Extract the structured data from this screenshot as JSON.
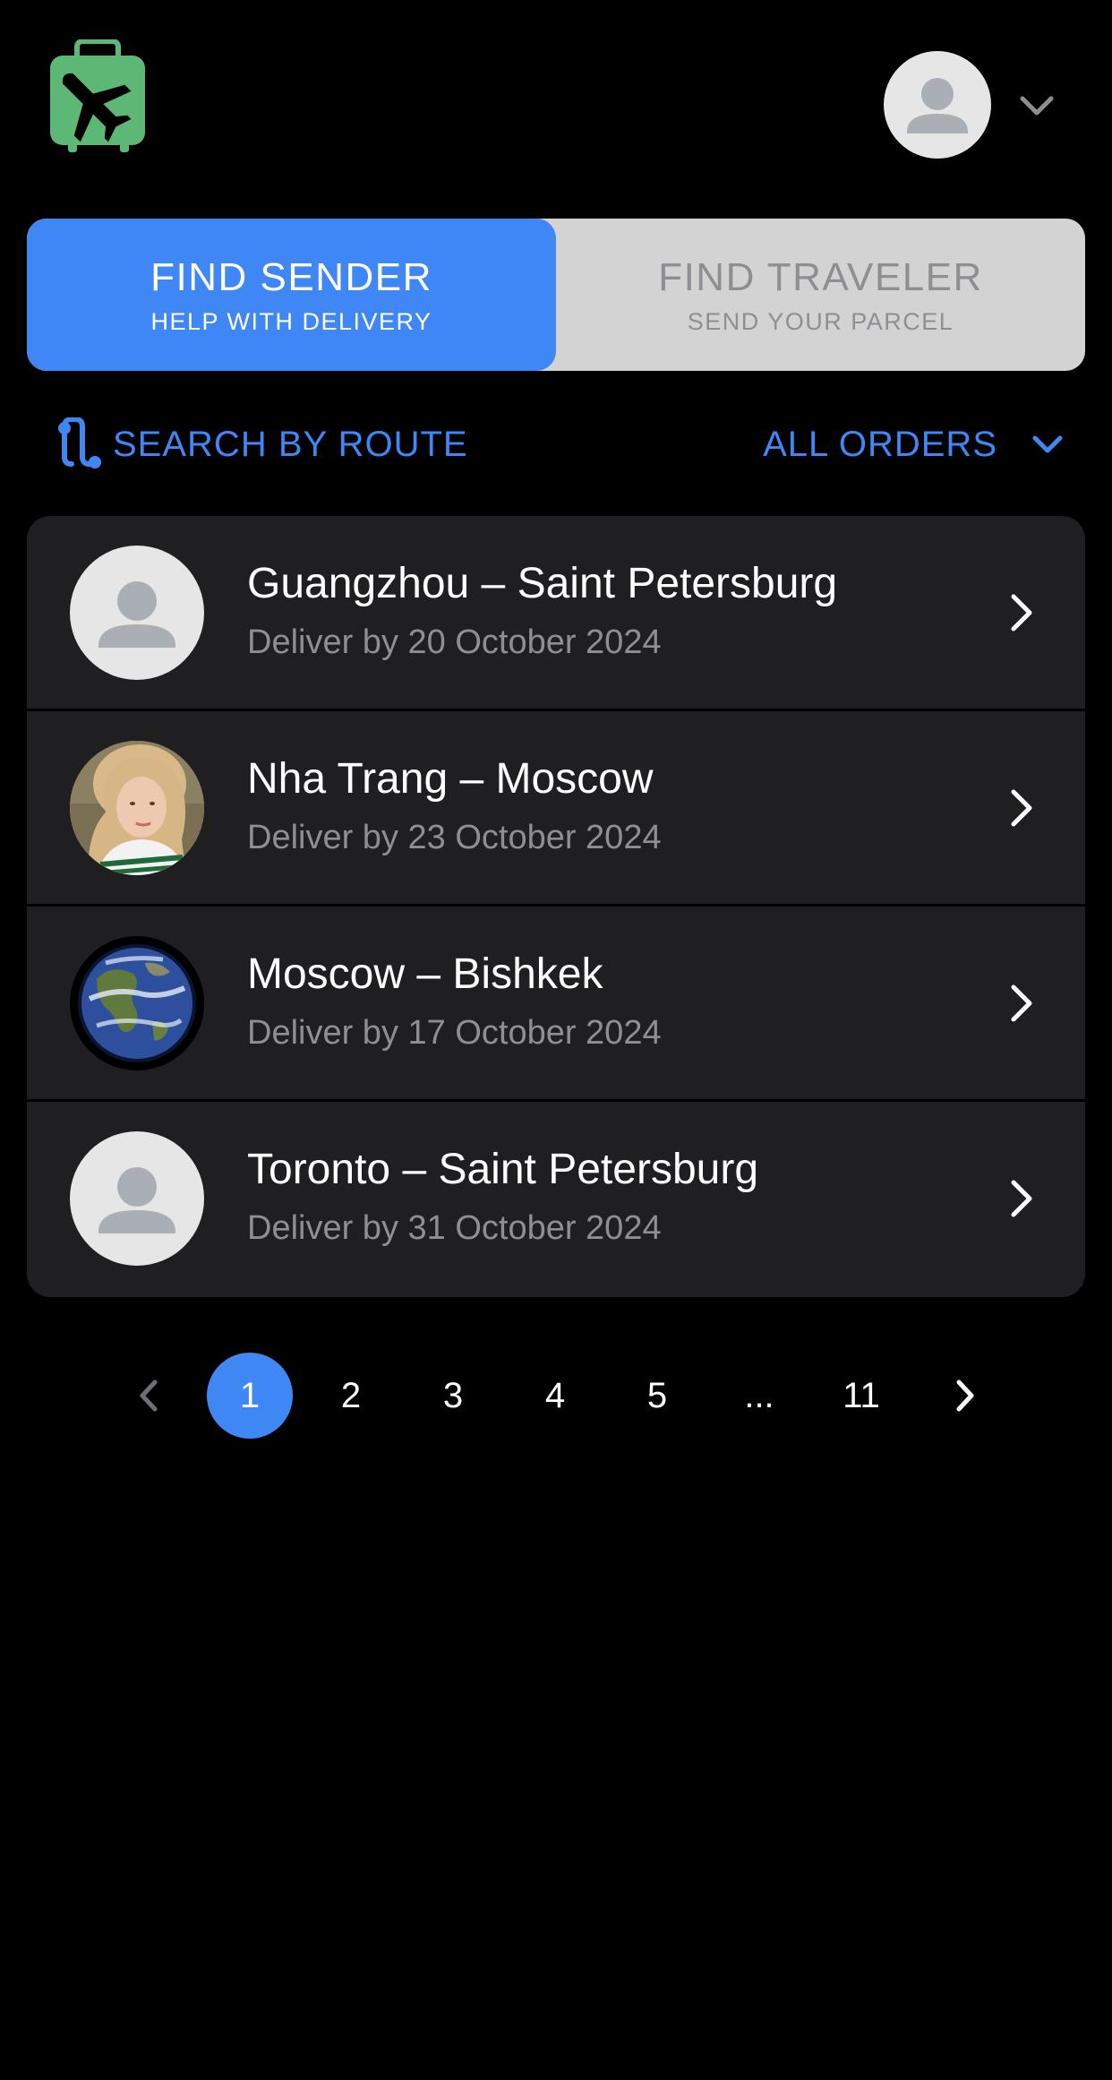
{
  "header": {
    "logo_icon": "luggage-airplane-icon",
    "brand_color": "#5cb874",
    "profile_icon": "user-avatar-icon",
    "menu_icon": "chevron-down-icon"
  },
  "mode_toggle": {
    "active_color": "#3f87f5",
    "tabs": [
      {
        "title": "FIND SENDER",
        "subtitle": "HELP WITH DELIVERY",
        "active": true
      },
      {
        "title": "FIND TRAVELER",
        "subtitle": "SEND YOUR PARCEL",
        "active": false
      }
    ]
  },
  "filters": {
    "route_icon": "route-icon",
    "route_label": "SEARCH BY ROUTE",
    "orders_label": "ALL ORDERS",
    "orders_icon": "chevron-down-icon"
  },
  "orders": [
    {
      "route": "Guangzhou – Saint Petersburg",
      "date": "Deliver by 20 October 2024",
      "avatar": "default-user-avatar"
    },
    {
      "route": "Nha Trang – Moscow",
      "date": "Deliver by 23 October 2024",
      "avatar": "user-photo-avatar"
    },
    {
      "route": "Moscow – Bishkek",
      "date": "Deliver by 17 October 2024",
      "avatar": "earth-globe-avatar"
    },
    {
      "route": "Toronto – Saint Petersburg",
      "date": "Deliver by 31 October 2024",
      "avatar": "default-user-avatar"
    }
  ],
  "pagination": {
    "prev_icon": "chevron-left-icon",
    "next_icon": "chevron-right-icon",
    "pages": [
      "1",
      "2",
      "3",
      "4",
      "5",
      "...",
      "11"
    ],
    "current": "1"
  }
}
